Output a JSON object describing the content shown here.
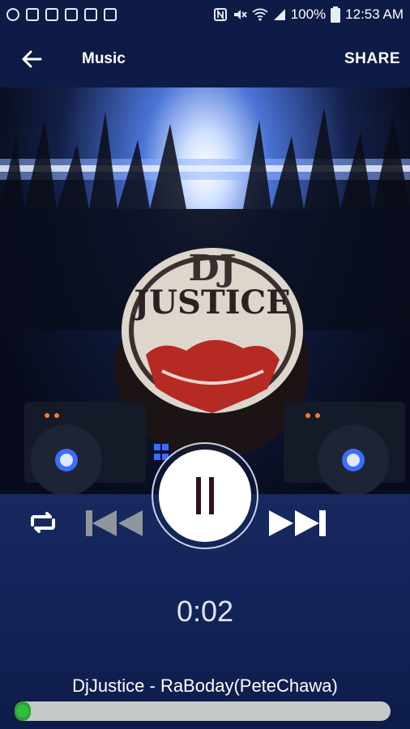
{
  "status_bar": {
    "battery": "100%",
    "time": "12:53 AM",
    "left_icons": [
      "location-icon",
      "checklist-icon",
      "image-icon",
      "calendar-icon",
      "flag-icon",
      "sd-card-icon"
    ],
    "right_icons": [
      "nfc-icon",
      "mute-icon",
      "wifi-icon",
      "signal-icon",
      "battery-icon"
    ]
  },
  "app_bar": {
    "title": "Music",
    "share_label": "SHARE",
    "back_icon": "back-arrow-icon"
  },
  "artwork": {
    "logo_line1": "DJ",
    "logo_line2": "JUSTICE"
  },
  "player": {
    "state": "playing",
    "elapsed": "0:02",
    "track_title": "DjJustice - RaBoday(PeteChawa)",
    "progress": 0.01,
    "icons": {
      "repeat": "repeat-icon",
      "previous": "skip-previous-icon",
      "pause": "pause-icon",
      "next": "skip-next-icon"
    }
  },
  "colors": {
    "background": "#0d1a45",
    "progress_track": "#c6c9c9",
    "progress_thumb": "#2fbf37",
    "pause_glyph": "#321018"
  }
}
